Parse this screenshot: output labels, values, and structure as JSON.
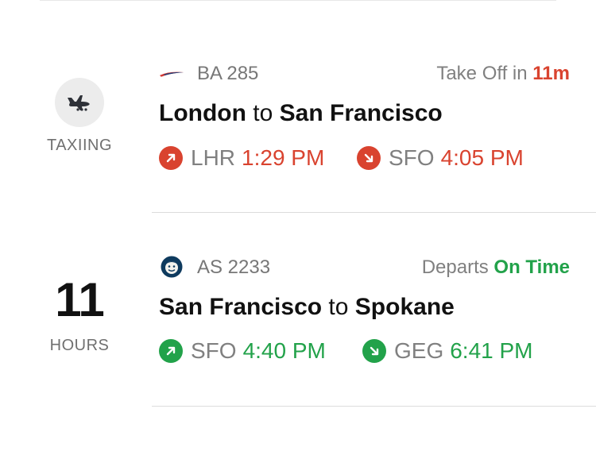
{
  "colors": {
    "delay_red": "#d9432f",
    "ontime_green": "#22a24a",
    "gray_text": "#777777",
    "divider": "#dcdcdc"
  },
  "flights": [
    {
      "left_status": {
        "icon": "plane-taxiing-icon",
        "label": "TAXIING"
      },
      "airline_logo": "british-airways-logo",
      "flight_number": "BA 285",
      "status_prefix": "Take Off in",
      "status_value": "11m",
      "status_color": "red",
      "route": {
        "from_city": "London",
        "connector": "to",
        "to_city": "San Francisco"
      },
      "departure": {
        "icon": "departure-arrow-icon",
        "code": "LHR",
        "time": "1:29 PM"
      },
      "arrival": {
        "icon": "arrival-arrow-icon",
        "code": "SFO",
        "time": "4:05 PM"
      }
    },
    {
      "left_status": {
        "number": "11",
        "label": "HOURS"
      },
      "airline_logo": "alaska-airlines-logo",
      "flight_number": "AS 2233",
      "status_prefix": "Departs",
      "status_value": "On Time",
      "status_color": "green",
      "route": {
        "from_city": "San Francisco",
        "connector": "to",
        "to_city": "Spokane"
      },
      "departure": {
        "icon": "departure-arrow-icon",
        "code": "SFO",
        "time": "4:40 PM"
      },
      "arrival": {
        "icon": "arrival-arrow-icon",
        "code": "GEG",
        "time": "6:41 PM"
      }
    }
  ]
}
